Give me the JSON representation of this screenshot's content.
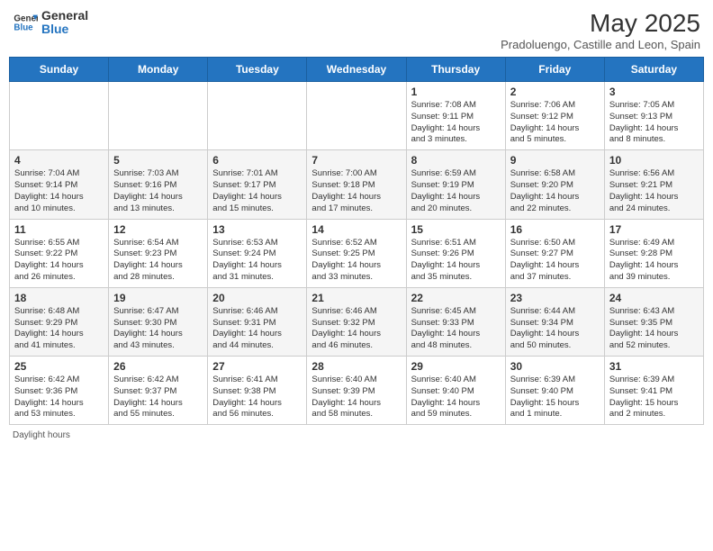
{
  "header": {
    "logo_line1": "General",
    "logo_line2": "Blue",
    "month_title": "May 2025",
    "subtitle": "Pradoluengo, Castille and Leon, Spain"
  },
  "days_of_week": [
    "Sunday",
    "Monday",
    "Tuesday",
    "Wednesday",
    "Thursday",
    "Friday",
    "Saturday"
  ],
  "footer": {
    "daylight_label": "Daylight hours"
  },
  "weeks": [
    {
      "days": [
        {
          "num": "",
          "info": ""
        },
        {
          "num": "",
          "info": ""
        },
        {
          "num": "",
          "info": ""
        },
        {
          "num": "",
          "info": ""
        },
        {
          "num": "1",
          "info": "Sunrise: 7:08 AM\nSunset: 9:11 PM\nDaylight: 14 hours\nand 3 minutes."
        },
        {
          "num": "2",
          "info": "Sunrise: 7:06 AM\nSunset: 9:12 PM\nDaylight: 14 hours\nand 5 minutes."
        },
        {
          "num": "3",
          "info": "Sunrise: 7:05 AM\nSunset: 9:13 PM\nDaylight: 14 hours\nand 8 minutes."
        }
      ]
    },
    {
      "days": [
        {
          "num": "4",
          "info": "Sunrise: 7:04 AM\nSunset: 9:14 PM\nDaylight: 14 hours\nand 10 minutes."
        },
        {
          "num": "5",
          "info": "Sunrise: 7:03 AM\nSunset: 9:16 PM\nDaylight: 14 hours\nand 13 minutes."
        },
        {
          "num": "6",
          "info": "Sunrise: 7:01 AM\nSunset: 9:17 PM\nDaylight: 14 hours\nand 15 minutes."
        },
        {
          "num": "7",
          "info": "Sunrise: 7:00 AM\nSunset: 9:18 PM\nDaylight: 14 hours\nand 17 minutes."
        },
        {
          "num": "8",
          "info": "Sunrise: 6:59 AM\nSunset: 9:19 PM\nDaylight: 14 hours\nand 20 minutes."
        },
        {
          "num": "9",
          "info": "Sunrise: 6:58 AM\nSunset: 9:20 PM\nDaylight: 14 hours\nand 22 minutes."
        },
        {
          "num": "10",
          "info": "Sunrise: 6:56 AM\nSunset: 9:21 PM\nDaylight: 14 hours\nand 24 minutes."
        }
      ]
    },
    {
      "days": [
        {
          "num": "11",
          "info": "Sunrise: 6:55 AM\nSunset: 9:22 PM\nDaylight: 14 hours\nand 26 minutes."
        },
        {
          "num": "12",
          "info": "Sunrise: 6:54 AM\nSunset: 9:23 PM\nDaylight: 14 hours\nand 28 minutes."
        },
        {
          "num": "13",
          "info": "Sunrise: 6:53 AM\nSunset: 9:24 PM\nDaylight: 14 hours\nand 31 minutes."
        },
        {
          "num": "14",
          "info": "Sunrise: 6:52 AM\nSunset: 9:25 PM\nDaylight: 14 hours\nand 33 minutes."
        },
        {
          "num": "15",
          "info": "Sunrise: 6:51 AM\nSunset: 9:26 PM\nDaylight: 14 hours\nand 35 minutes."
        },
        {
          "num": "16",
          "info": "Sunrise: 6:50 AM\nSunset: 9:27 PM\nDaylight: 14 hours\nand 37 minutes."
        },
        {
          "num": "17",
          "info": "Sunrise: 6:49 AM\nSunset: 9:28 PM\nDaylight: 14 hours\nand 39 minutes."
        }
      ]
    },
    {
      "days": [
        {
          "num": "18",
          "info": "Sunrise: 6:48 AM\nSunset: 9:29 PM\nDaylight: 14 hours\nand 41 minutes."
        },
        {
          "num": "19",
          "info": "Sunrise: 6:47 AM\nSunset: 9:30 PM\nDaylight: 14 hours\nand 43 minutes."
        },
        {
          "num": "20",
          "info": "Sunrise: 6:46 AM\nSunset: 9:31 PM\nDaylight: 14 hours\nand 44 minutes."
        },
        {
          "num": "21",
          "info": "Sunrise: 6:46 AM\nSunset: 9:32 PM\nDaylight: 14 hours\nand 46 minutes."
        },
        {
          "num": "22",
          "info": "Sunrise: 6:45 AM\nSunset: 9:33 PM\nDaylight: 14 hours\nand 48 minutes."
        },
        {
          "num": "23",
          "info": "Sunrise: 6:44 AM\nSunset: 9:34 PM\nDaylight: 14 hours\nand 50 minutes."
        },
        {
          "num": "24",
          "info": "Sunrise: 6:43 AM\nSunset: 9:35 PM\nDaylight: 14 hours\nand 52 minutes."
        }
      ]
    },
    {
      "days": [
        {
          "num": "25",
          "info": "Sunrise: 6:42 AM\nSunset: 9:36 PM\nDaylight: 14 hours\nand 53 minutes."
        },
        {
          "num": "26",
          "info": "Sunrise: 6:42 AM\nSunset: 9:37 PM\nDaylight: 14 hours\nand 55 minutes."
        },
        {
          "num": "27",
          "info": "Sunrise: 6:41 AM\nSunset: 9:38 PM\nDaylight: 14 hours\nand 56 minutes."
        },
        {
          "num": "28",
          "info": "Sunrise: 6:40 AM\nSunset: 9:39 PM\nDaylight: 14 hours\nand 58 minutes."
        },
        {
          "num": "29",
          "info": "Sunrise: 6:40 AM\nSunset: 9:40 PM\nDaylight: 14 hours\nand 59 minutes."
        },
        {
          "num": "30",
          "info": "Sunrise: 6:39 AM\nSunset: 9:40 PM\nDaylight: 15 hours\nand 1 minute."
        },
        {
          "num": "31",
          "info": "Sunrise: 6:39 AM\nSunset: 9:41 PM\nDaylight: 15 hours\nand 2 minutes."
        }
      ]
    }
  ]
}
